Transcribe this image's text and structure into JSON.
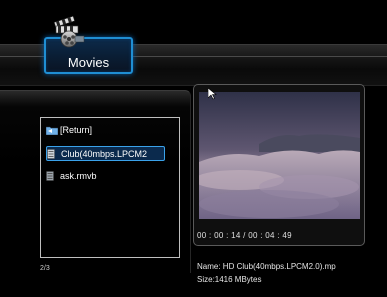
{
  "header": {
    "title": "Movies",
    "icon": "clapperboard-icon"
  },
  "file_list": {
    "items": [
      {
        "label": "[Return]",
        "icon": "return-folder-icon",
        "selected": false
      },
      {
        "label": "Club(40mbps.LPCM2",
        "icon": "video-file-icon",
        "selected": true
      },
      {
        "label": "ask.rmvb",
        "icon": "video-file-icon",
        "selected": false
      }
    ],
    "page_indicator": "2/3"
  },
  "preview": {
    "time_display": "00 : 00 : 14 / 00 : 04 : 49",
    "name_line": "Name: HD Club(40mbps.LPCM2.0).mp",
    "size_line": "Size:1416 MBytes"
  },
  "colors": {
    "accent": "#1f8ed3",
    "selection_bg": "#0b2a4d",
    "background": "#000000"
  }
}
